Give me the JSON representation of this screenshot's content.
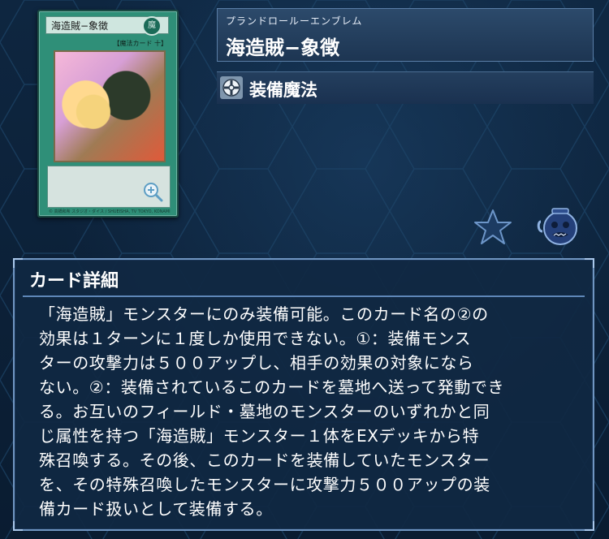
{
  "card": {
    "name_small": "海造賊−象徴",
    "attribute_glyph": "魔",
    "type_small": "【魔法カード 十】",
    "footer": "© 高橋和希 スタジオ・ダイス / SHUEISHA, TV TOKYO, KONAMI"
  },
  "header": {
    "reading": "プランドロールーエンブレム",
    "name": "海造賊−象徴"
  },
  "type_line": {
    "icon": "equip-spell-icon",
    "label": "装備魔法"
  },
  "actions": {
    "favorite_icon": "star-icon",
    "deck_icon": "pot-icon"
  },
  "details": {
    "title": "カード詳細",
    "text": "「海造賊」モンスターにのみ装備可能。このカード名の②の\n効果は１ターンに１度しか使用できない。①：装備モンス\nターの攻撃力は５００アップし、相手の効果の対象になら\nない。②：装備されているこのカードを墓地へ送って発動でき\nる。お互いのフィールド・墓地のモンスターのいずれかと同\nじ属性を持つ「海造賊」モンスター１体をEXデッキから特\n殊召喚する。その後、このカードを装備していたモンスター\nを、その特殊召喚したモンスターに攻撃力５００アップの装\n備カード扱いとして装備する。"
  },
  "colors": {
    "background": "#0b1f35",
    "panel_border": "#6f95c1",
    "spell_card": "#2f8f78"
  }
}
